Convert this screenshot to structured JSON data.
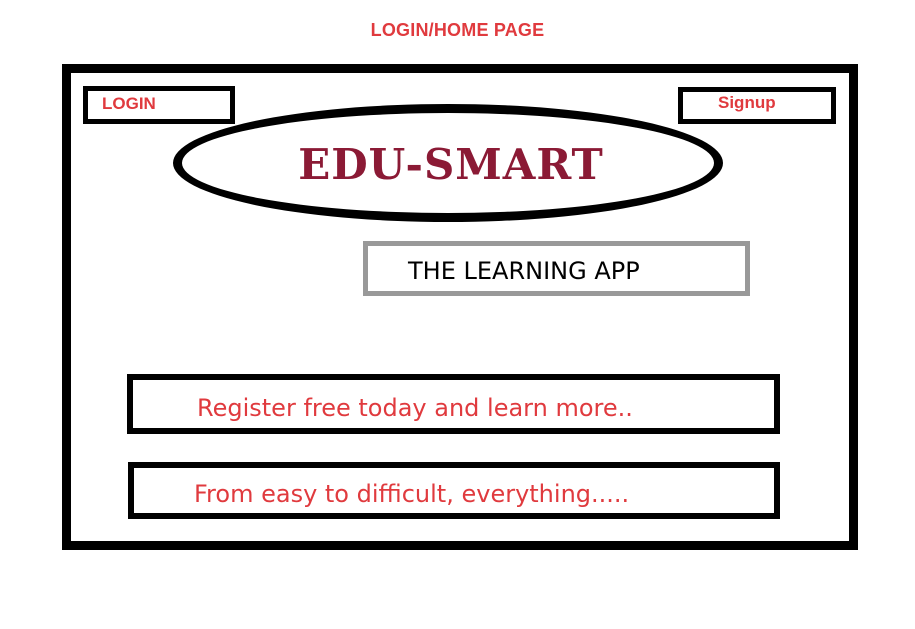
{
  "page": {
    "caption": "LOGIN/HOME PAGE"
  },
  "header": {
    "login_label": "LOGIN",
    "signup_label": "Signup"
  },
  "logo": {
    "text": "EDU-SMART"
  },
  "tagline": {
    "text": "THE LEARNING APP"
  },
  "promos": [
    {
      "text": "Register free today and learn more.."
    },
    {
      "text": "From easy to difficult, everything....."
    }
  ],
  "colors": {
    "accent_red": "#e03a3e",
    "logo_maroon": "#8b1a35",
    "border_black": "#000000",
    "tagline_border_gray": "#999999"
  }
}
